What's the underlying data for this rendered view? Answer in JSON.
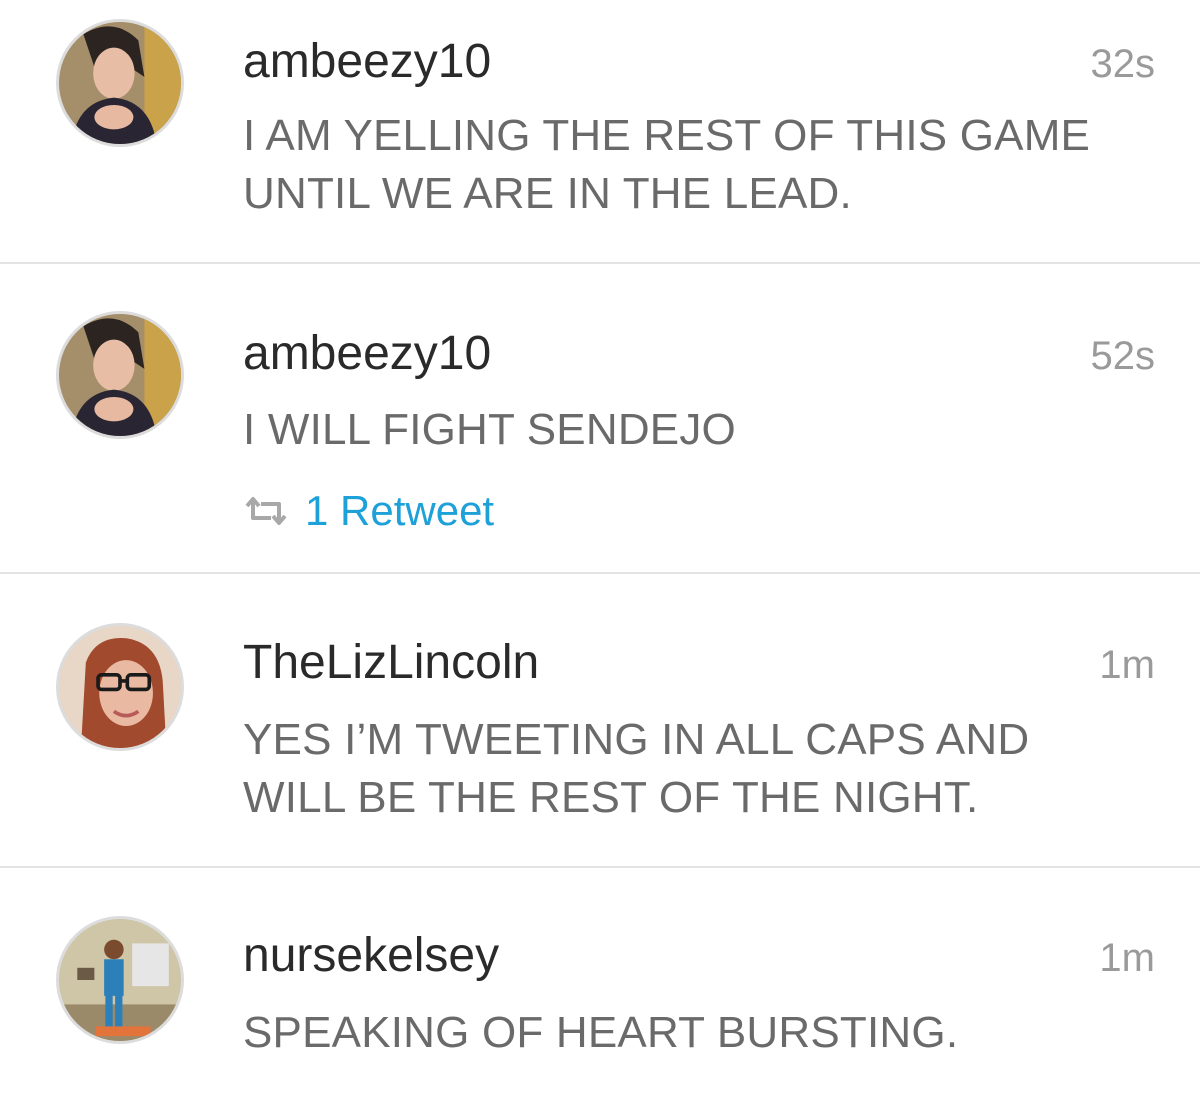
{
  "tweets": [
    {
      "username": "ambeezy10",
      "time": "32s",
      "text_lines": [
        "I AM YELLING THE REST OF THIS GAME",
        "UNTIL WE ARE IN THE LEAD."
      ],
      "avatar_icon": "user-photo-icon"
    },
    {
      "username": "ambeezy10",
      "time": "52s",
      "text_lines": [
        "I WILL FIGHT SENDEJO"
      ],
      "retweet_label": "1 Retweet",
      "retweet_icon": "retweet-icon",
      "avatar_icon": "user-photo-icon"
    },
    {
      "username": "TheLizLincoln",
      "time": "1m",
      "text_lines": [
        "YES I’M TWEETING IN ALL CAPS AND",
        "WILL BE THE REST OF THE NIGHT."
      ],
      "avatar_icon": "user-photo-icon"
    },
    {
      "username": "nursekelsey",
      "time": "1m",
      "text_lines": [
        "SPEAKING OF HEART BURSTING."
      ],
      "avatar_icon": "user-photo-icon"
    }
  ],
  "colors": {
    "username": "#2a2a2a",
    "text": "#6a6a6a",
    "time": "#9a9a9a",
    "retweet": "#1da1d8",
    "divider": "#e3e3e3"
  }
}
